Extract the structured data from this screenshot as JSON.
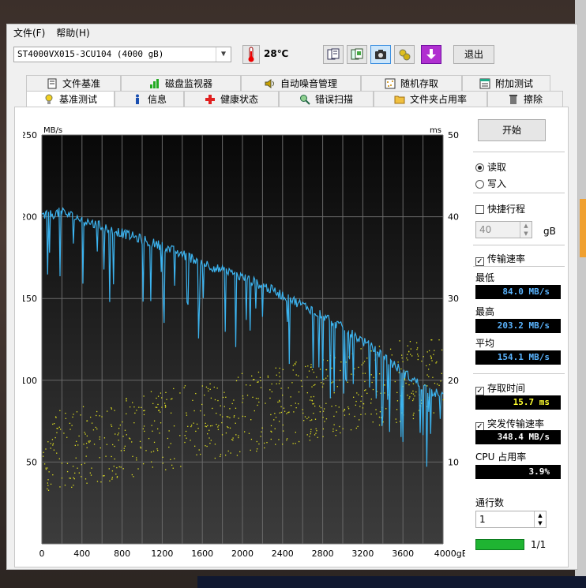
{
  "menu": {
    "file": "文件(F)",
    "help": "帮助(H)"
  },
  "toolbar": {
    "drive": "ST4000VX015-3CU104 (4000 gB)",
    "temperature": "28℃",
    "exit": "退出"
  },
  "tabs_top": [
    {
      "label": "文件基准",
      "icon": "file-benchmark-icon"
    },
    {
      "label": "磁盘监视器",
      "icon": "disk-monitor-icon"
    },
    {
      "label": "自动噪音管理",
      "icon": "speaker-icon"
    },
    {
      "label": "随机存取",
      "icon": "random-access-icon"
    },
    {
      "label": "附加测试",
      "icon": "extra-tests-icon"
    }
  ],
  "tabs_bottom": [
    {
      "label": "基准测试",
      "icon": "benchmark-icon"
    },
    {
      "label": "信息",
      "icon": "info-icon"
    },
    {
      "label": "健康状态",
      "icon": "health-icon"
    },
    {
      "label": "错误扫描",
      "icon": "error-scan-icon"
    },
    {
      "label": "文件夹占用率",
      "icon": "folder-usage-icon"
    },
    {
      "label": "擦除",
      "icon": "erase-icon"
    }
  ],
  "controls": {
    "start": "开始",
    "read": "读取",
    "write": "写入",
    "quick_stroke": "快捷行程",
    "quick_value": "40",
    "gb_unit": "gB",
    "transfer_rate": "传输速率",
    "min_label": "最低",
    "min_value": "84.0 MB/s",
    "max_label": "最高",
    "max_value": "203.2 MB/s",
    "avg_label": "平均",
    "avg_value": "154.1 MB/s",
    "access_time": "存取时间",
    "access_value": "15.7 ms",
    "burst_rate": "突发传输速率",
    "burst_value": "348.4 MB/s",
    "cpu_label": "CPU 占用率",
    "cpu_value": "3.9%",
    "passes_label": "通行数",
    "passes_value": "1",
    "progress_text": "1/1",
    "progress_fraction": 1.0
  },
  "chart_data": {
    "type": "line",
    "ylabel": "MB/s",
    "y2label": "ms",
    "xunit": "gB",
    "xlim": [
      0,
      4000
    ],
    "ylim": [
      0,
      250
    ],
    "y2lim": [
      0,
      50
    ],
    "xticks": [
      "0",
      "400",
      "800",
      "1200",
      "1600",
      "2000",
      "2400",
      "2800",
      "3200",
      "3600",
      "4000gB"
    ],
    "yticks": [
      "250",
      "200",
      "150",
      "100",
      "50"
    ],
    "y2ticks": [
      "50",
      "40",
      "30",
      "20",
      "10"
    ],
    "grid": true,
    "series": [
      {
        "type": "line",
        "color": "#3cb4f0",
        "x": [
          0,
          200,
          400,
          600,
          800,
          1000,
          1200,
          1400,
          1600,
          1800,
          2000,
          2200,
          2400,
          2600,
          2800,
          3000,
          3200,
          3400,
          3600,
          3800,
          4000
        ],
        "y": [
          200,
          203,
          198,
          194,
          190,
          186,
          182,
          177,
          172,
          167,
          163,
          158,
          152,
          146,
          140,
          132,
          124,
          115,
          105,
          96,
          90
        ]
      },
      {
        "type": "scatter",
        "color": "#e0e020",
        "axis": "right",
        "x_range": [
          0,
          4000
        ],
        "y_range_ms": [
          4,
          25
        ]
      }
    ]
  }
}
